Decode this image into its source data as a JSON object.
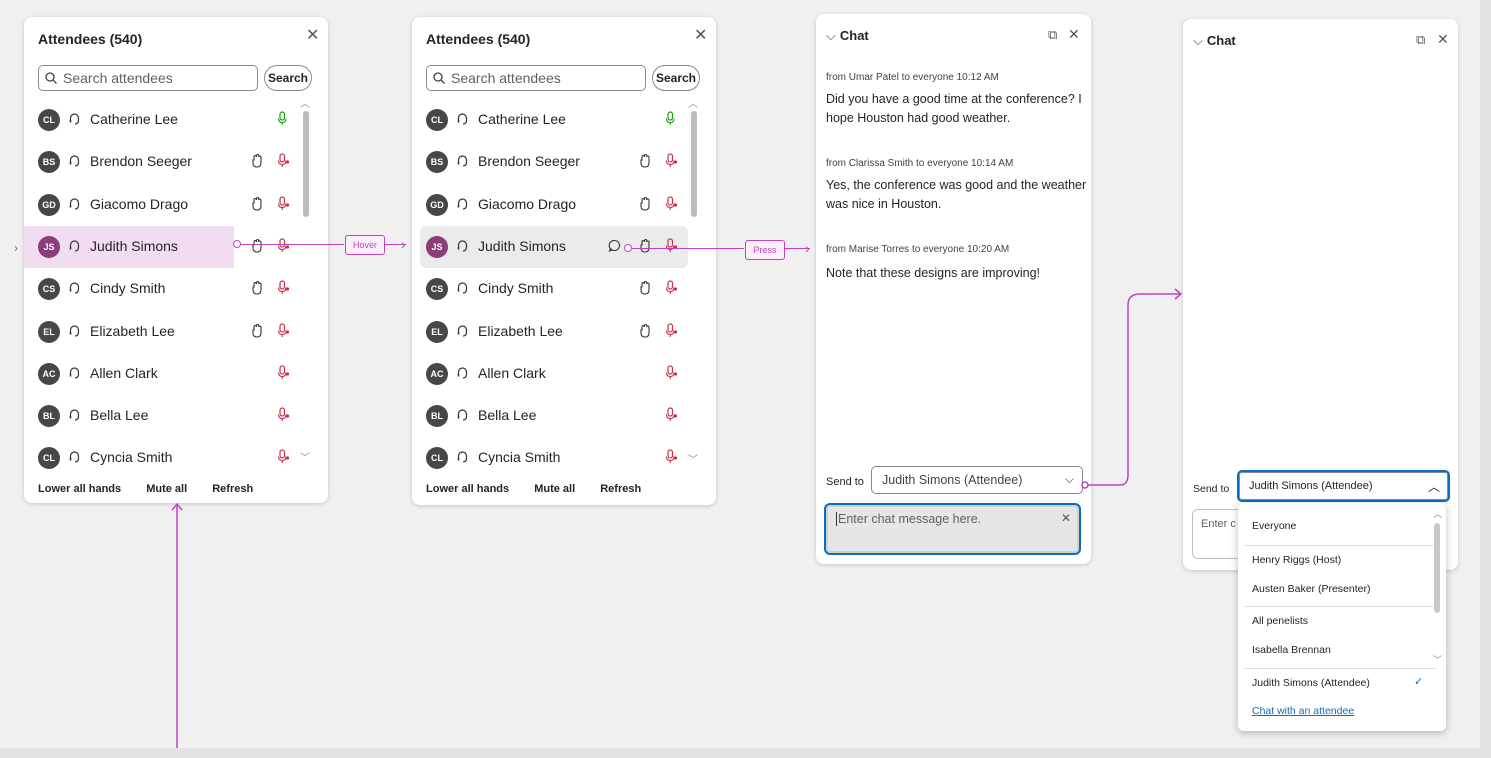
{
  "panel1": {
    "title": "Attendees (540)",
    "search_placeholder": "Search attendees",
    "search_button": "Search",
    "attendees": [
      {
        "initials": "CL",
        "name": "Catherine Lee",
        "hand": false,
        "mic": "green"
      },
      {
        "initials": "BS",
        "name": "Brendon Seeger",
        "hand": true,
        "mic": "muted"
      },
      {
        "initials": "GD",
        "name": "Giacomo Drago",
        "hand": true,
        "mic": "muted"
      },
      {
        "initials": "JS",
        "name": "Judith Simons",
        "hand": true,
        "mic": "muted"
      },
      {
        "initials": "CS",
        "name": "Cindy Smith",
        "hand": true,
        "mic": "muted"
      },
      {
        "initials": "EL",
        "name": "Elizabeth Lee",
        "hand": true,
        "mic": "muted"
      },
      {
        "initials": "AC",
        "name": "Allen Clark",
        "hand": false,
        "mic": "muted"
      },
      {
        "initials": "BL",
        "name": "Bella Lee",
        "hand": false,
        "mic": "muted"
      },
      {
        "initials": "CL",
        "name": "Cyncia Smith",
        "hand": false,
        "mic": "muted"
      }
    ],
    "footer": {
      "lower": "Lower all hands",
      "mute": "Mute all",
      "refresh": "Refresh"
    }
  },
  "panel2": {
    "title": "Attendees (540)",
    "search_placeholder": "Search attendees",
    "search_button": "Search",
    "footer": {
      "lower": "Lower all hands",
      "mute": "Mute all",
      "refresh": "Refresh"
    }
  },
  "annotations": {
    "hover": "Hover",
    "press": "Press"
  },
  "chat": {
    "title": "Chat",
    "messages": [
      {
        "meta": "from Umar Patel to everyone   10:12 AM",
        "text": "Did you have a good time at the conference? I hope Houston had good weather."
      },
      {
        "meta": "from Clarissa Smith to everyone   10:14 AM",
        "text": "Yes, the conference was good and the weather was nice in Houston."
      },
      {
        "meta": "from Marise Torres to everyone   10:20 AM",
        "text": "Note that these designs are improving!"
      }
    ],
    "send_to_label": "Send to",
    "send_to_value": "Judith Simons (Attendee)",
    "input_placeholder": "Enter chat message here."
  },
  "chat2": {
    "title": "Chat",
    "send_to_label": "Send to",
    "send_to_value": "Judith Simons (Attendee)",
    "input_partial": "Enter c",
    "options": [
      "Everyone",
      "Henry Riggs (Host)",
      "Austen Baker (Presenter)",
      "All penelists",
      "Isabella Brennan",
      "Judith Simons (Attendee)"
    ],
    "link": "Chat with an attendee"
  },
  "colors": {
    "accent": "#c044c0",
    "focus": "#0f6cbd",
    "mic_green": "#13a10e",
    "mic_red": "#c4314b",
    "hover_bg": "#f2dcf2"
  }
}
